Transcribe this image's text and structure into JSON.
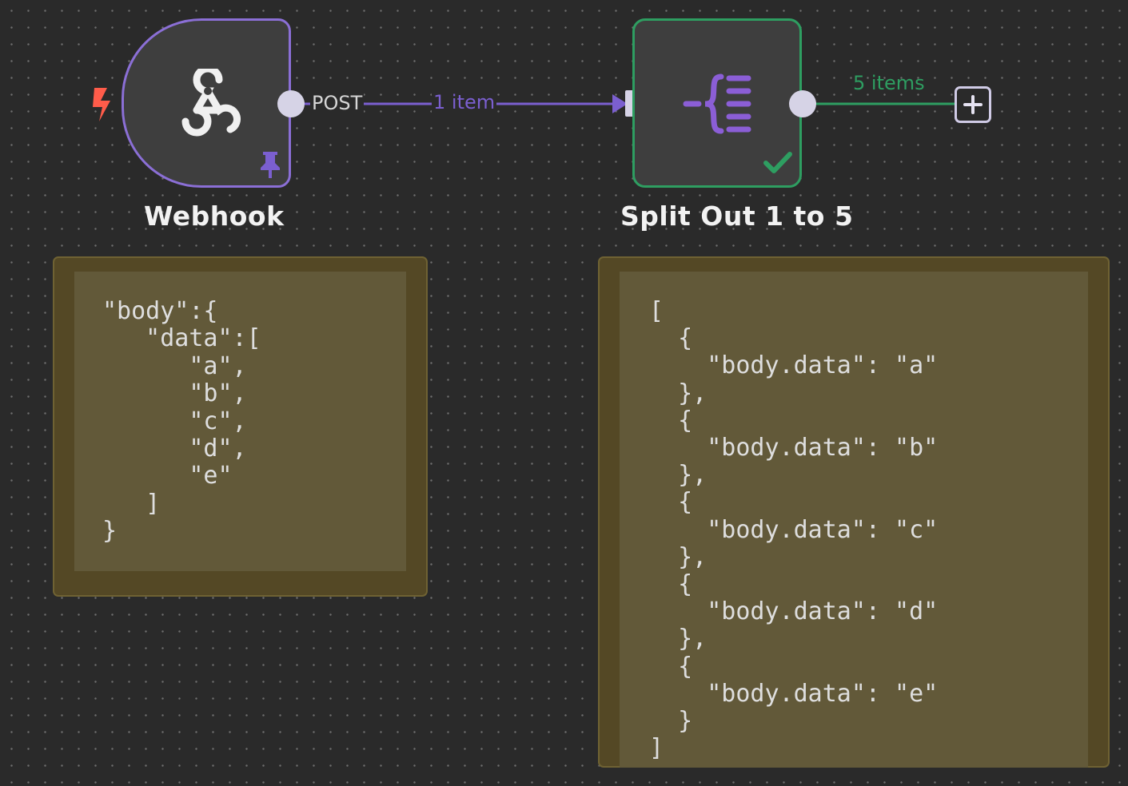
{
  "workflow": {
    "nodes": [
      {
        "title": "Webhook",
        "icon": "webhook-icon",
        "trigger_icon": "lightning-bolt-icon",
        "badge_icon": "pin-icon"
      },
      {
        "title": "Split Out 1 to 5",
        "icon": "split-out-icon",
        "status_icon": "checkmark-icon"
      }
    ],
    "connections": [
      {
        "output_label": "POST",
        "items_label": "1 item",
        "color": "#7b5fd0"
      },
      {
        "items_label": "5 items",
        "color": "#2e9e61"
      }
    ],
    "add_node_icon": "plus-icon"
  },
  "sticky_notes": [
    {
      "content": "\"body\":{\n   \"data\":[\n      \"a\",\n      \"b\",\n      \"c\",\n      \"d\",\n      \"e\"\n   ]\n}"
    },
    {
      "content": "[\n  {\n    \"body.data\": \"a\"\n  },\n  {\n    \"body.data\": \"b\"\n  },\n  {\n    \"body.data\": \"c\"\n  },\n  {\n    \"body.data\": \"d\"\n  },\n  {\n    \"body.data\": \"e\"\n  }\n]"
    }
  ],
  "colors": {
    "canvas_background": "#2a2a2a",
    "webhook_border": "#8b6fd6",
    "success_border": "#2e9e61",
    "trigger_red": "#ff5c4a",
    "sticky_background": "#625939"
  }
}
